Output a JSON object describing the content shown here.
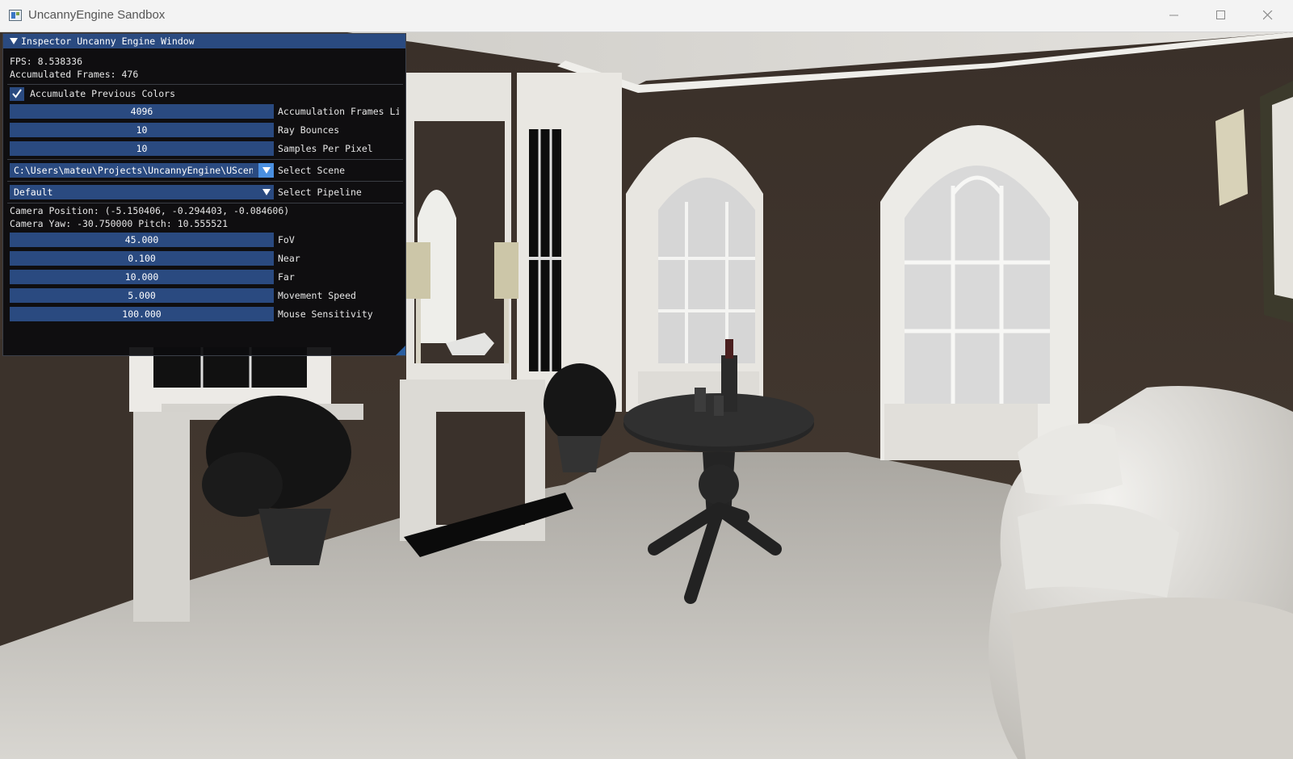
{
  "window": {
    "title": "UncannyEngine Sandbox",
    "icon": "app-icon",
    "controls": [
      "minimize-icon",
      "maximize-icon",
      "close-icon"
    ]
  },
  "inspector": {
    "title": "Inspector Uncanny Engine Window",
    "fps": "FPS: 8.538336",
    "accumulated_frames": "Accumulated Frames: 476",
    "accumulate_colors": {
      "label": "Accumulate Previous Colors",
      "checked": true
    },
    "accumulation_limit": {
      "value": "4096",
      "label": "Accumulation Frames Limit"
    },
    "ray_bounces": {
      "value": "10",
      "label": "Ray Bounces"
    },
    "samples_per_pixel": {
      "value": "10",
      "label": "Samples Per Pixel"
    },
    "scene": {
      "value": "C:\\Users\\mateu\\Projects\\UncannyEngine\\UScenes\\",
      "label": "Select Scene"
    },
    "pipeline": {
      "value": "Default",
      "label": "Select Pipeline"
    },
    "camera_position": "Camera Position: (-5.150406, -0.294403, -0.084606)",
    "camera_yaw_pitch": "Camera Yaw: -30.750000 Pitch: 10.555521",
    "fov": {
      "value": "45.000",
      "label": "FoV"
    },
    "near": {
      "value": "0.100",
      "label": "Near"
    },
    "far": {
      "value": "10.000",
      "label": "Far"
    },
    "movement_speed": {
      "value": "5.000",
      "label": "Movement Speed"
    },
    "mouse_sensitivity": {
      "value": "100.000",
      "label": "Mouse Sensitivity"
    }
  },
  "colors": {
    "imgui_accent": "#2a4a80",
    "imgui_active": "#4a8fe0",
    "wall": "#3e342c",
    "floor": "#c9c6c0"
  }
}
